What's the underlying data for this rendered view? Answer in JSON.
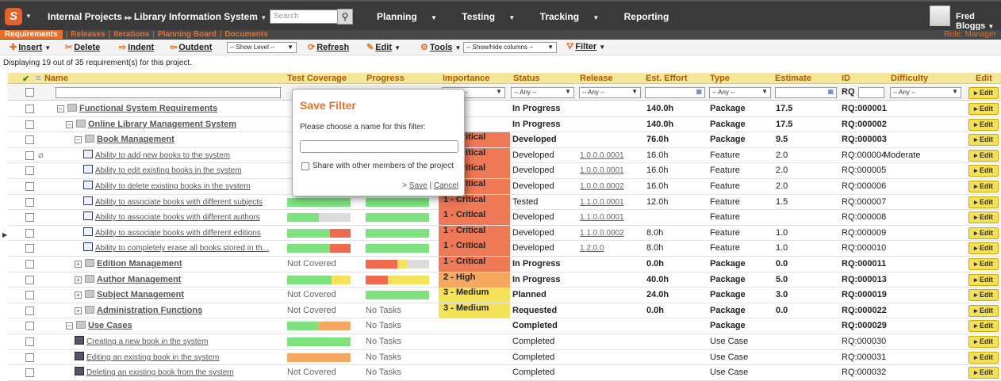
{
  "topbar": {
    "logo": "S",
    "project": "Internal Projects",
    "product": "Library Information System",
    "search_placeholder": "Search",
    "nav": [
      "Planning",
      "Testing",
      "Tracking",
      "Reporting"
    ],
    "user": "Fred Bloggs"
  },
  "subnav": {
    "tabs": [
      "Requirements",
      "Releases",
      "Iterations",
      "Planning Board",
      "Documents"
    ],
    "role": "Role: Manager"
  },
  "toolbar": {
    "insert": "Insert",
    "delete": "Delete",
    "indent": "Indent",
    "outdent": "Outdent",
    "show_level": "-- Show Level --",
    "refresh": "Refresh",
    "edit": "Edit",
    "tools": "Tools",
    "show_hide": "-- Show/hide columns --",
    "filter": "Filter"
  },
  "display_count": "Displaying 19 out of 35 requirement(s) for this project.",
  "columns": [
    "Name",
    "Test Coverage",
    "Progress",
    "Importance",
    "Status",
    "Release",
    "Est. Effort",
    "Type",
    "Estimate",
    "ID",
    "Difficulty",
    "Edit"
  ],
  "filters": {
    "any": "-- Any --",
    "id_label": "RQ"
  },
  "edit_label": "Edit",
  "rows": [
    {
      "name": "Functional System Requirements",
      "indent": 0,
      "kind": "folder",
      "bold": true,
      "exp": "−",
      "coverage": [],
      "progress": [],
      "importance": "",
      "status": "In Progress",
      "status_bold": true,
      "release": "",
      "effort": "140.0h",
      "effort_bold": true,
      "type": "Package",
      "type_bold": true,
      "estimate": "17.5",
      "id": "RQ:000001",
      "difficulty": ""
    },
    {
      "name": "Online Library Management System",
      "indent": 1,
      "kind": "folder",
      "bold": true,
      "exp": "−",
      "coverage": [],
      "progress": [],
      "importance": "",
      "status": "In Progress",
      "status_bold": true,
      "release": "",
      "effort": "140.0h",
      "effort_bold": true,
      "type": "Package",
      "type_bold": true,
      "estimate": "17.5",
      "id": "RQ:000002",
      "difficulty": ""
    },
    {
      "name": "Book Management",
      "indent": 2,
      "kind": "folder",
      "bold": true,
      "exp": "−",
      "coverage": [],
      "progress": [],
      "importance": "1 - Critical",
      "importance_color": "#ef7856",
      "status": "Developed",
      "status_bold": true,
      "release": "",
      "effort": "76.0h",
      "effort_bold": true,
      "type": "Package",
      "type_bold": true,
      "estimate": "9.5",
      "id": "RQ:000003",
      "difficulty": ""
    },
    {
      "name": "Ability to add new books to the system",
      "indent": 3,
      "kind": "req",
      "bold": false,
      "coverage": [],
      "progress": [],
      "importance": "1 - Critical",
      "importance_color": "#ef7856",
      "status": "Developed",
      "release": "1.0.0.0.0001",
      "effort": "16.0h",
      "type": "Feature",
      "estimate": "2.0",
      "id": "RQ:000004",
      "difficulty": "Moderate",
      "attachment": true
    },
    {
      "name": "Ability to edit existing books in the system",
      "indent": 3,
      "kind": "req",
      "bold": false,
      "coverage": [],
      "progress": [],
      "importance": "1 - Critical",
      "importance_color": "#ef7856",
      "status": "Developed",
      "release": "1.0.0.0.0001",
      "effort": "16.0h",
      "type": "Feature",
      "estimate": "2.0",
      "id": "RQ:000005",
      "difficulty": ""
    },
    {
      "name": "Ability to delete existing books in the system",
      "indent": 3,
      "kind": "req",
      "bold": false,
      "coverage": [],
      "progress": [],
      "importance": "1 - Critical",
      "importance_color": "#ef7856",
      "status": "Developed",
      "release": "1.0.0.0.0002",
      "effort": "16.0h",
      "type": "Feature",
      "estimate": "2.0",
      "id": "RQ:000006",
      "difficulty": ""
    },
    {
      "name": "Ability to associate books with different subjects",
      "indent": 3,
      "kind": "req",
      "bold": false,
      "coverage": [
        {
          "w": 1.0,
          "c": "#7ee27e"
        }
      ],
      "progress": [
        {
          "w": 1.0,
          "c": "#7ee27e"
        }
      ],
      "importance": "1 - Critical",
      "importance_color": "#ef7856",
      "status": "Tested",
      "release": "1.1.0.0.0001",
      "effort": "12.0h",
      "type": "Feature",
      "estimate": "1.5",
      "id": "RQ:000007",
      "difficulty": ""
    },
    {
      "name": "Ability to associate books with different authors",
      "indent": 3,
      "kind": "req",
      "bold": false,
      "coverage": [
        {
          "w": 0.5,
          "c": "#7ee27e"
        },
        {
          "w": 0.5,
          "c": "#dcdcdc"
        }
      ],
      "progress": [
        {
          "w": 1.0,
          "c": "#7ee27e"
        }
      ],
      "importance": "1 - Critical",
      "importance_color": "#ef7856",
      "status": "Developed",
      "release": "1.1.0.0.0001",
      "effort": "",
      "type": "Feature",
      "estimate": "",
      "id": "RQ:000008",
      "difficulty": ""
    },
    {
      "name": "Ability to associate books with different editions",
      "indent": 3,
      "kind": "req",
      "bold": false,
      "coverage": [
        {
          "w": 0.67,
          "c": "#7ee27e"
        },
        {
          "w": 0.33,
          "c": "#ef6a4e"
        }
      ],
      "progress": [
        {
          "w": 1.0,
          "c": "#7ee27e"
        }
      ],
      "importance": "1 - Critical",
      "importance_color": "#ef7856",
      "status": "Developed",
      "release": "1.1.0.0.0002",
      "effort": "8.0h",
      "type": "Feature",
      "estimate": "1.0",
      "id": "RQ:000009",
      "difficulty": ""
    },
    {
      "name": "Ability to completely erase all books stored in th...",
      "indent": 3,
      "kind": "req",
      "bold": false,
      "coverage": [
        {
          "w": 0.67,
          "c": "#7ee27e"
        },
        {
          "w": 0.33,
          "c": "#ef6a4e"
        }
      ],
      "progress": [
        {
          "w": 1.0,
          "c": "#7ee27e"
        }
      ],
      "importance": "1 - Critical",
      "importance_color": "#ef7856",
      "status": "Developed",
      "release": "1.2.0.0",
      "effort": "8.0h",
      "type": "Feature",
      "estimate": "1.0",
      "id": "RQ:000010",
      "difficulty": ""
    },
    {
      "name": "Edition Management",
      "indent": 2,
      "kind": "folder",
      "bold": true,
      "exp": "+",
      "coverage_text": "Not Covered",
      "coverage": [],
      "progress": [
        {
          "w": 0.5,
          "c": "#ef6a4e"
        },
        {
          "w": 0.15,
          "c": "#f3e25a"
        },
        {
          "w": 0.35,
          "c": "#dcdcdc"
        }
      ],
      "importance": "1 - Critical",
      "importance_color": "#ef7856",
      "status": "In Progress",
      "status_bold": true,
      "release": "",
      "effort": "0.0h",
      "effort_bold": true,
      "type": "Package",
      "type_bold": true,
      "estimate": "0.0",
      "id": "RQ:000011",
      "difficulty": ""
    },
    {
      "name": "Author Management",
      "indent": 2,
      "kind": "folder",
      "bold": true,
      "exp": "+",
      "coverage": [
        {
          "w": 0.7,
          "c": "#7ee27e"
        },
        {
          "w": 0.3,
          "c": "#f3e25a"
        }
      ],
      "progress": [
        {
          "w": 0.35,
          "c": "#ef6a4e"
        },
        {
          "w": 0.05,
          "c": "#f3e25a"
        },
        {
          "w": 0.6,
          "c": "#f3e25a"
        }
      ],
      "importance": "2 - High",
      "importance_color": "#f4a860",
      "status": "In Progress",
      "status_bold": true,
      "release": "",
      "effort": "40.0h",
      "effort_bold": true,
      "type": "Package",
      "type_bold": true,
      "estimate": "5.0",
      "id": "RQ:000013",
      "difficulty": ""
    },
    {
      "name": "Subject Management",
      "indent": 2,
      "kind": "folder",
      "bold": true,
      "exp": "+",
      "coverage_text": "Not Covered",
      "coverage": [],
      "progress": [
        {
          "w": 1.0,
          "c": "#7ee27e"
        }
      ],
      "importance": "3 - Medium",
      "importance_color": "#f3e25a",
      "status": "Planned",
      "status_bold": true,
      "release": "",
      "effort": "24.0h",
      "effort_bold": true,
      "type": "Package",
      "type_bold": true,
      "estimate": "3.0",
      "id": "RQ:000019",
      "difficulty": ""
    },
    {
      "name": "Administration Functions",
      "indent": 2,
      "kind": "folder",
      "bold": true,
      "exp": "+",
      "coverage_text": "Not Covered",
      "coverage": [],
      "progress_text": "No Tasks",
      "progress": [],
      "importance": "3 - Medium",
      "importance_color": "#f3e25a",
      "status": "Requested",
      "status_bold": true,
      "release": "",
      "effort": "0.0h",
      "effort_bold": true,
      "type": "Package",
      "type_bold": true,
      "estimate": "0.0",
      "id": "RQ:000022",
      "difficulty": ""
    },
    {
      "name": "Use Cases",
      "indent": 1,
      "kind": "folder",
      "bold": true,
      "exp": "−",
      "coverage": [
        {
          "w": 0.5,
          "c": "#7ee27e"
        },
        {
          "w": 0.5,
          "c": "#f4a860"
        }
      ],
      "progress_text": "No Tasks",
      "progress": [],
      "importance": "",
      "status": "Completed",
      "status_bold": true,
      "release": "",
      "effort": "",
      "type": "Package",
      "type_bold": true,
      "estimate": "",
      "id": "RQ:000029",
      "difficulty": ""
    },
    {
      "name": "Creating a new book in the system",
      "indent": 2,
      "kind": "usecase",
      "bold": false,
      "coverage": [
        {
          "w": 1.0,
          "c": "#7ee27e"
        }
      ],
      "progress_text": "No Tasks",
      "progress": [],
      "importance": "",
      "status": "Completed",
      "release": "",
      "effort": "",
      "type": "Use Case",
      "estimate": "",
      "id": "RQ:000030",
      "difficulty": ""
    },
    {
      "name": "Editing an existing book in the system",
      "indent": 2,
      "kind": "usecase",
      "bold": false,
      "coverage": [
        {
          "w": 1.0,
          "c": "#f4a860"
        }
      ],
      "progress_text": "No Tasks",
      "progress": [],
      "importance": "",
      "status": "Completed",
      "release": "",
      "effort": "",
      "type": "Use Case",
      "estimate": "",
      "id": "RQ:000031",
      "difficulty": ""
    },
    {
      "name": "Deleting an existing book from the system",
      "indent": 2,
      "kind": "usecase",
      "bold": false,
      "coverage_text": "Not Covered",
      "coverage": [],
      "progress_text": "No Tasks",
      "progress": [],
      "importance": "",
      "status": "Completed",
      "release": "",
      "effort": "",
      "type": "Use Case",
      "estimate": "",
      "id": "RQ:000032",
      "difficulty": ""
    }
  ],
  "save_filter": {
    "title": "Save Filter",
    "prompt": "Please choose a name for this filter:",
    "share_label": "Share with other members of the project",
    "prefix": "> ",
    "save": "Save",
    "divider": " | ",
    "cancel": "Cancel"
  }
}
